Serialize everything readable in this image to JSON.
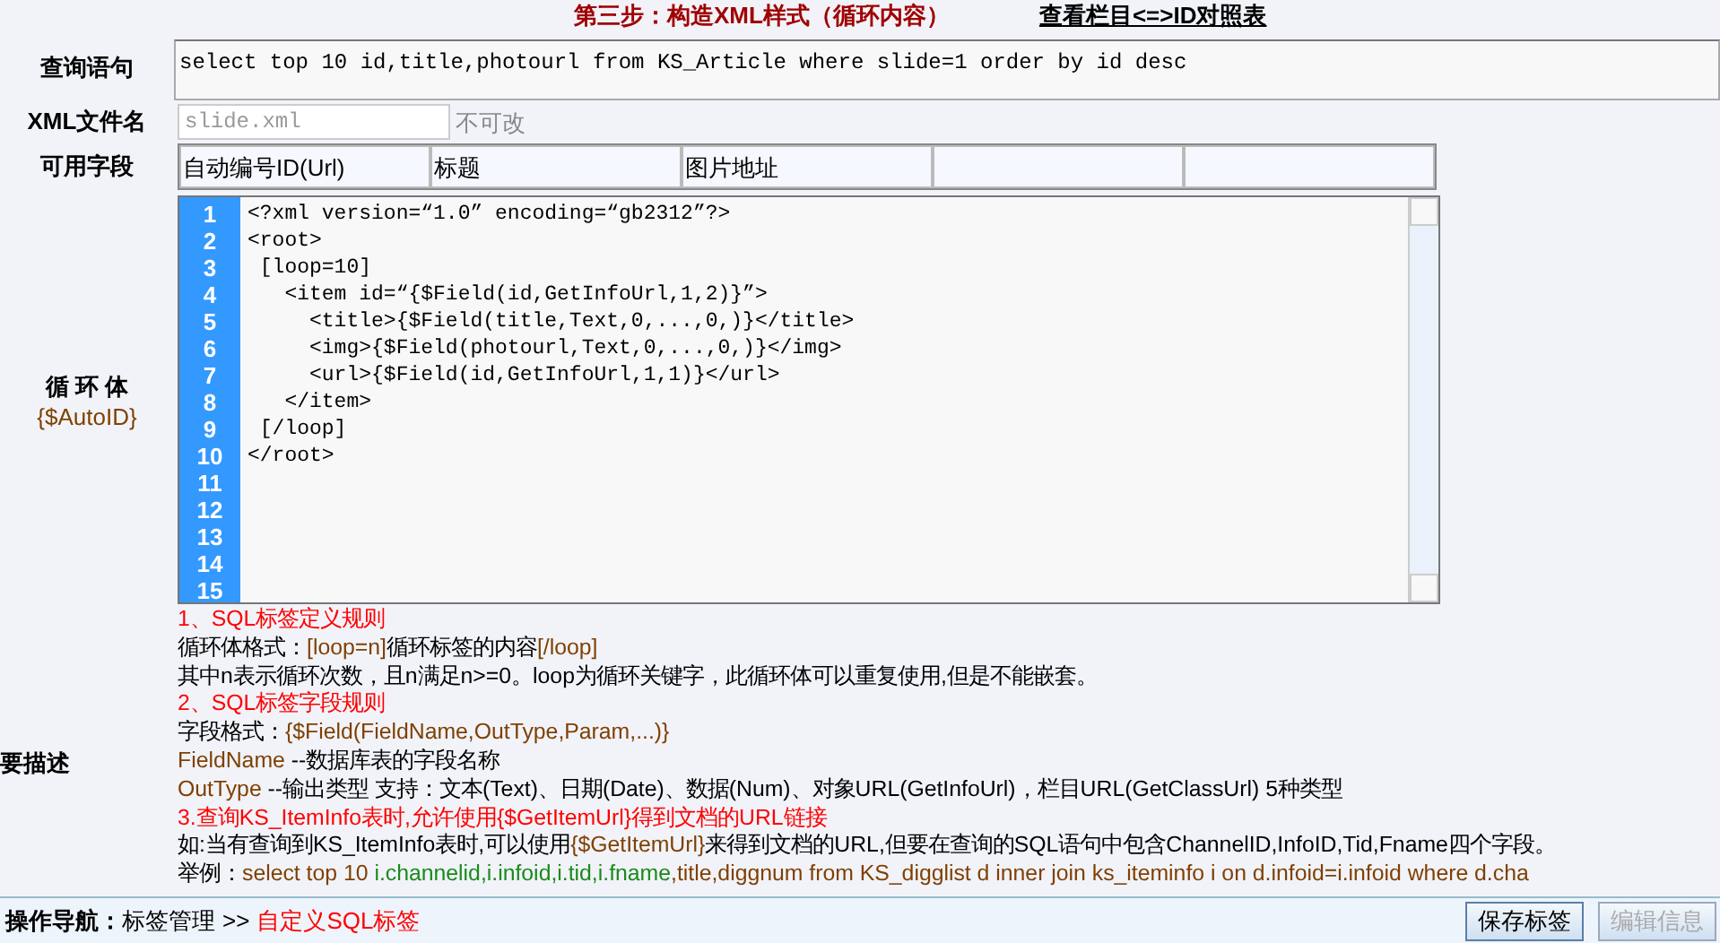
{
  "header": {
    "step_title": "第三步：构造XML样式（循环内容）",
    "link": "查看栏目<=>ID对照表"
  },
  "query": {
    "label": "查询语句",
    "value": "select top 10 id,title,photourl from KS_Article where slide=1 order by id desc"
  },
  "xml_file": {
    "label": "XML文件名",
    "value": "slide.xml",
    "disabled": true,
    "note": "不可改"
  },
  "fields": {
    "label": "可用字段",
    "items": [
      "自动编号ID(Url)",
      "标题",
      "图片地址"
    ]
  },
  "loop_body": {
    "label": "循 环 体",
    "sublabel": "{$AutoID}",
    "line_numbers": [
      "1",
      "2",
      "3",
      "4",
      "5",
      "6",
      "7",
      "8",
      "9",
      "10",
      "11",
      "12",
      "13",
      "14",
      "15"
    ],
    "code": [
      "<?xml version=“1.0” encoding=“gb2312”?>",
      "<root>",
      " [loop=10]",
      "   <item id=“{$Field(id,GetInfoUrl,1,2)}”>",
      "     <title>{$Field(title,Text,0,...,0,)}</title>",
      "     <img>{$Field(photourl,Text,0,...,0,)}</img>",
      "     <url>{$Field(id,GetInfoUrl,1,1)}</url>",
      "   </item>",
      " [/loop]",
      "</root>"
    ]
  },
  "description": {
    "label": "要描述",
    "lines": [
      {
        "kind": "heading",
        "segments": [
          {
            "kind": "plain",
            "text": "1、SQL标签定义规则"
          }
        ]
      },
      {
        "kind": "text",
        "segments": [
          {
            "kind": "plain",
            "text": "循环体格式："
          },
          {
            "kind": "code",
            "text": "[loop=n]"
          },
          {
            "kind": "plain",
            "text": "循环标签的内容"
          },
          {
            "kind": "code",
            "text": "[/loop]"
          }
        ]
      },
      {
        "kind": "text",
        "segments": [
          {
            "kind": "plain",
            "text": "其中n表示循环次数，且n满足n>=0。loop为循环关键字，此循环体可以重复使用,但是不能嵌套。"
          }
        ]
      },
      {
        "kind": "heading",
        "segments": [
          {
            "kind": "plain",
            "text": "2、SQL标签字段规则"
          }
        ]
      },
      {
        "kind": "text",
        "segments": [
          {
            "kind": "plain",
            "text": "字段格式："
          },
          {
            "kind": "code",
            "text": "{$Field(FieldName,OutType,Param,...)}"
          }
        ]
      },
      {
        "kind": "text",
        "segments": [
          {
            "kind": "code",
            "text": "FieldName"
          },
          {
            "kind": "plain",
            "text": "  --数据库表的字段名称"
          }
        ]
      },
      {
        "kind": "text",
        "segments": [
          {
            "kind": "code",
            "text": "OutType"
          },
          {
            "kind": "plain",
            "text": "    --输出类型  支持：文本(Text)、日期(Date)、数据(Num)、对象URL(GetInfoUrl)，栏目URL(GetClassUrl) 5种类型"
          }
        ]
      },
      {
        "kind": "heading",
        "segments": [
          {
            "kind": "plain",
            "text": "3.查询KS_ItemInfo表时,允许使用{$GetItemUrl}得到文档的URL链接"
          }
        ]
      },
      {
        "kind": "text",
        "segments": [
          {
            "kind": "plain",
            "text": "如:当有查询到KS_ItemInfo表时,可以使用"
          },
          {
            "kind": "code",
            "text": "{$GetItemUrl}"
          },
          {
            "kind": "plain",
            "text": "来得到文档的URL,但要在查询的SQL语句中包含ChannelID,InfoID,Tid,Fname四个字段。"
          }
        ]
      },
      {
        "kind": "text",
        "segments": [
          {
            "kind": "plain",
            "text": "举例："
          },
          {
            "kind": "code",
            "text": "select top 10 "
          },
          {
            "kind": "sql",
            "text": "i.channelid,i.infoid,i.tid,i.fname"
          },
          {
            "kind": "code",
            "text": ",title,diggnum from KS_digglist d inner join ks_iteminfo i on d.infoid=i.infoid where d.cha"
          }
        ]
      }
    ]
  },
  "footer": {
    "label": "操作导航：",
    "crumbs": [
      {
        "text": "标签管理",
        "current": false
      },
      {
        "text": "自定义SQL标签",
        "current": true
      }
    ],
    "separator": ">>",
    "buttons": [
      {
        "label": "保存标签",
        "disabled": false
      },
      {
        "label": "编辑信息",
        "disabled": true
      }
    ]
  }
}
